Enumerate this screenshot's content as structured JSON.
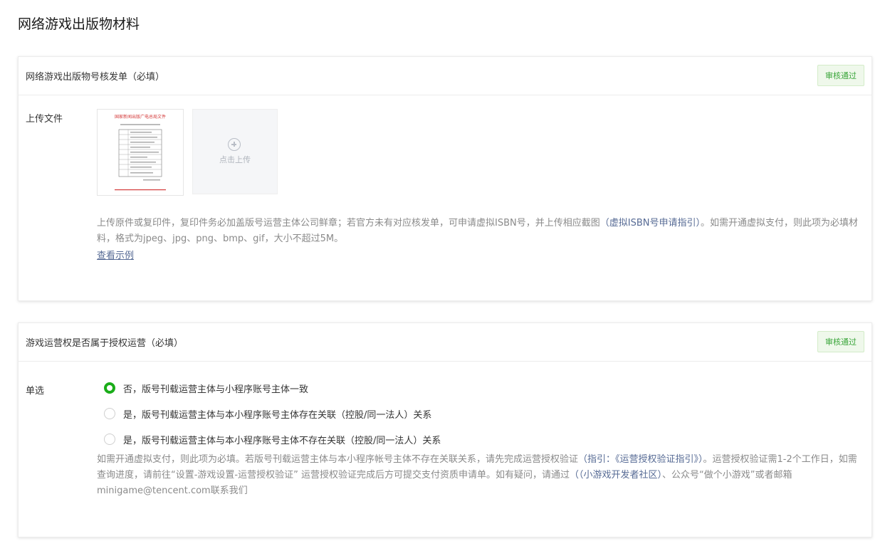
{
  "page": {
    "title": "网络游戏出版物材料"
  },
  "section1": {
    "title": "网络游戏出版物号核发单（必填）",
    "status": "审核通过",
    "field_label": "上传文件",
    "upload_text": "点击上传",
    "thumbnail": {
      "header_text": "国家新闻出版广电总局文件"
    },
    "hint_before": "上传原件或复印件，复印件务必加盖版号运营主体公司鲜章；若官方未有对应核发单，可申请虚拟ISBN号，并上传相应截图",
    "hint_link": "（虚拟ISBN号申请指引）",
    "hint_after": "。如需开通虚拟支付，则此项为必填材料，格式为jpeg、jpg、png、bmp、gif，大小不超过5M。",
    "example_link": "查看示例"
  },
  "section2": {
    "title": "游戏运营权是否属于授权运营（必填）",
    "status": "审核通过",
    "field_label": "单选",
    "options": [
      {
        "label": "否，版号刊载运营主体与小程序账号主体一致",
        "checked": true
      },
      {
        "label": "是，版号刊载运营主体与本小程序账号主体存在关联（控股/同一法人）关系",
        "checked": false
      },
      {
        "label": "是，版号刊载运营主体与本小程序账号主体不存在关联（控股/同一法人）关系",
        "checked": false
      }
    ],
    "hint_part1": "如需开通虚拟支付，则此项为必填。若版号刊载运营主体与本小程序帐号主体不存在关联关系，请先完成运营授权验证",
    "hint_link1": "（指引：《运营授权验证指引》）",
    "hint_part2": "。运营授权验证需1-2个工作日，如需查询进度，请前往“设置-游戏设置-运营授权验证” 运营授权验证完成后方可提交支付资质申请单。如有疑问，请通过",
    "hint_link2": "（（小游戏开发者社区）",
    "hint_part3": "、公众号“做个小游戏”或者邮箱minigame@tencent.com联系我们"
  },
  "colors": {
    "link": "#576b95",
    "success": "#3aa53a",
    "radio_checked": "#1aad19"
  }
}
